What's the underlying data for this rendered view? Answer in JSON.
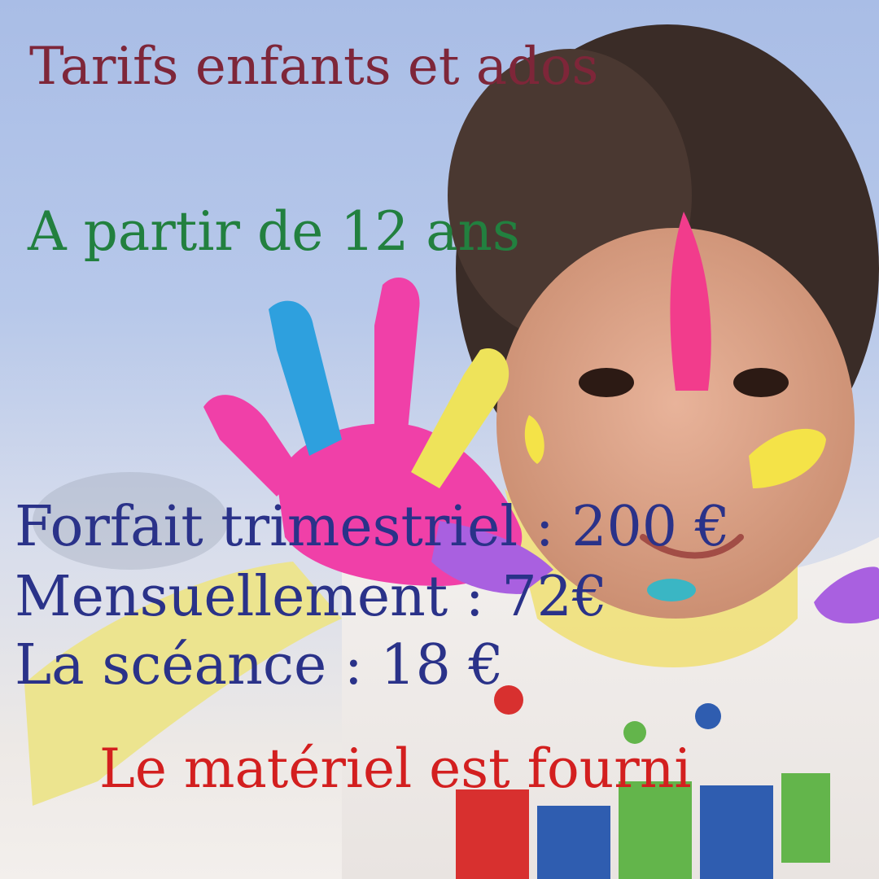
{
  "title": "Tarifs enfants et ados",
  "age_line": "A partir de 12 ans",
  "prices": [
    "Forfait trimestriel : 200 €",
    "Mensuellement : 72€",
    "La scéance : 18 €"
  ],
  "note": "Le matériel est fourni",
  "colors": {
    "title": "#7e2639",
    "age_line": "#22803f",
    "prices": "#2a3289",
    "note": "#d31f1f"
  },
  "photo": {
    "description_icon": "child-painted-hand-photo"
  }
}
